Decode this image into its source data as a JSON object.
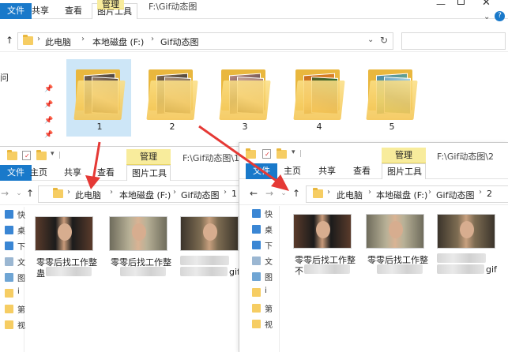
{
  "back_window": {
    "title": "F:\\Gif动态图",
    "tabs": {
      "file": "文件",
      "home": "共享",
      "view": "查看",
      "tools": "图片工具",
      "manage": "管理"
    },
    "breadcrumb": [
      "此电脑",
      "本地磁盘 (F:)",
      "Gif动态图"
    ],
    "side_text": "问",
    "folders": [
      {
        "label": "1"
      },
      {
        "label": "2"
      },
      {
        "label": "3"
      },
      {
        "label": "4"
      },
      {
        "label": "5"
      }
    ]
  },
  "window_left": {
    "title": "F:\\Gif动态图\\1",
    "tabs": {
      "file": "文件",
      "home": "主页",
      "share": "共享",
      "view": "查看",
      "tools": "图片工具",
      "manage": "管理"
    },
    "breadcrumb": [
      "此电脑",
      "本地磁盘 (F:)",
      "Gif动态图",
      "1"
    ],
    "side_labels": [
      "快",
      "桌",
      "下",
      "文",
      "图",
      "i",
      "第",
      "视"
    ],
    "files": [
      {
        "caption": "零零后找工作整",
        "caption2": "蛊"
      },
      {
        "caption": "零零后找工作整",
        "caption2": ""
      },
      {
        "caption": "",
        "caption2": "gif"
      }
    ]
  },
  "window_right": {
    "title": "F:\\Gif动态图\\2",
    "tabs": {
      "file": "文件",
      "home": "主页",
      "share": "共享",
      "view": "查看",
      "tools": "图片工具",
      "manage": "管理"
    },
    "breadcrumb": [
      "此电脑",
      "本地磁盘 (F:)",
      "Gif动态图",
      "2"
    ],
    "side_labels": [
      "快",
      "桌",
      "下",
      "文",
      "图",
      "i",
      "第",
      "视"
    ],
    "files": [
      {
        "caption": "零零后找工作整",
        "caption2": "不"
      },
      {
        "caption": "零零后找工作整",
        "caption2": ""
      },
      {
        "caption": "",
        "caption2": "gif"
      }
    ]
  },
  "colors": {
    "arrow": "#e53935",
    "accent": "#1979ca",
    "manage": "#f8ec9c",
    "folder": "#f6cd63"
  }
}
